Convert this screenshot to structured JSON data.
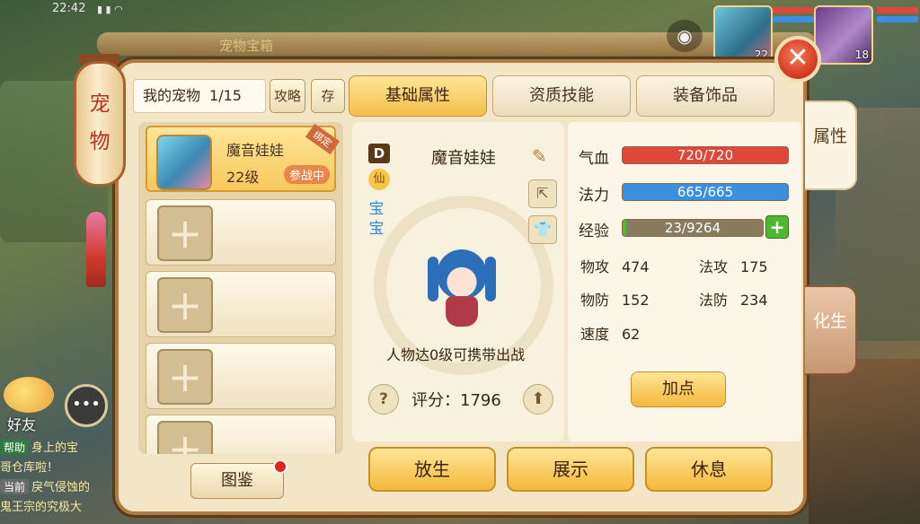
{
  "status": {
    "time": "22:42",
    "icons": "▮ ▮ ◠"
  },
  "faded_title": "宠物宝箱",
  "top_right": {
    "camera_icon": "camera-icon",
    "avatars": [
      {
        "level": "22"
      },
      {
        "level": "18"
      }
    ]
  },
  "lantern": {
    "chars": [
      "宠",
      "物"
    ]
  },
  "chat": {
    "friends_label": "好友",
    "lines": [
      {
        "tag": "帮助",
        "text": "身上的宝"
      },
      {
        "tag": "",
        "text": "哥仓库啦！"
      },
      {
        "tag": "当前",
        "text": "戾气侵蚀的"
      },
      {
        "tag": "",
        "text": "鬼王宗的究极大"
      }
    ]
  },
  "header": {
    "my_pets": "我的宠物",
    "count": "1/15",
    "guide": "攻略",
    "save": "存"
  },
  "tabs": [
    {
      "label": "基础属性",
      "active": true
    },
    {
      "label": "资质技能",
      "active": false
    },
    {
      "label": "装备饰品",
      "active": false
    }
  ],
  "side_tabs": [
    "属性",
    "化生"
  ],
  "pet_list": {
    "selected": {
      "name": "魔音娃娃",
      "level": "22级",
      "status": "参战中",
      "bound": "绑定"
    },
    "empty_slots": 4
  },
  "atlas_button": "图鉴",
  "center": {
    "rank": "D",
    "xian": "仙",
    "baobao": "宝宝",
    "name": "魔音娃娃",
    "carry_hint": "人物达0级可携带出战",
    "score_label": "评分：",
    "score": "1796"
  },
  "bars": [
    {
      "label": "气血",
      "text": "720/720",
      "ratio": 1.0,
      "color": "#e0463a"
    },
    {
      "label": "法力",
      "text": "665/665",
      "ratio": 1.0,
      "color": "#3a8fe0"
    },
    {
      "label": "经验",
      "text": "23/9264",
      "ratio": 0.0025,
      "color": "#4fb832"
    }
  ],
  "stats": [
    {
      "k": "物攻",
      "v": "474"
    },
    {
      "k": "法攻",
      "v": "175"
    },
    {
      "k": "物防",
      "v": "152"
    },
    {
      "k": "法防",
      "v": "234"
    },
    {
      "k": "速度",
      "v": "62"
    }
  ],
  "add_point": "加点",
  "bottom_buttons": [
    "放生",
    "展示",
    "休息"
  ],
  "close_icon": "close-icon"
}
